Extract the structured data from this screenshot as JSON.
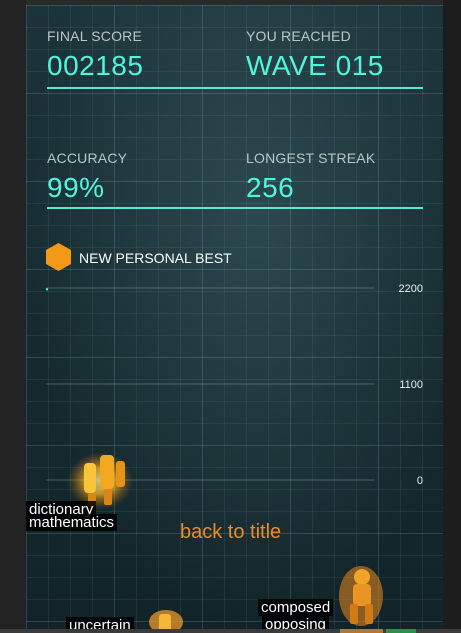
{
  "stats": {
    "final_score": {
      "label": "FINAL SCORE",
      "value": "002185"
    },
    "reached": {
      "label": "YOU REACHED",
      "value": "WAVE 015"
    },
    "accuracy": {
      "label": "ACCURACY",
      "value": "99%"
    },
    "streak": {
      "label": "LONGEST STREAK",
      "value": "256"
    }
  },
  "personal_best": {
    "label": "NEW PERSONAL BEST"
  },
  "chart_data": {
    "type": "line",
    "title": "",
    "xlabel": "",
    "ylabel": "",
    "ylim": [
      0,
      2200
    ],
    "y_ticks": [
      "2200",
      "1100",
      "0"
    ],
    "series": [
      {
        "values": [
          2185
        ]
      }
    ],
    "grid": true,
    "colors": {
      "series": "#4ff5dc",
      "gridline": "#6f8f94"
    }
  },
  "back_button": {
    "label": "back to title"
  },
  "words": {
    "w1": "dictionary",
    "w2": "mathematics",
    "w3": "uncertain",
    "w4": "composed",
    "w5": "opposing"
  },
  "colors": {
    "accent": "#4ff5dc",
    "orange": "#f08a22",
    "best_badge": "#f29a18"
  }
}
